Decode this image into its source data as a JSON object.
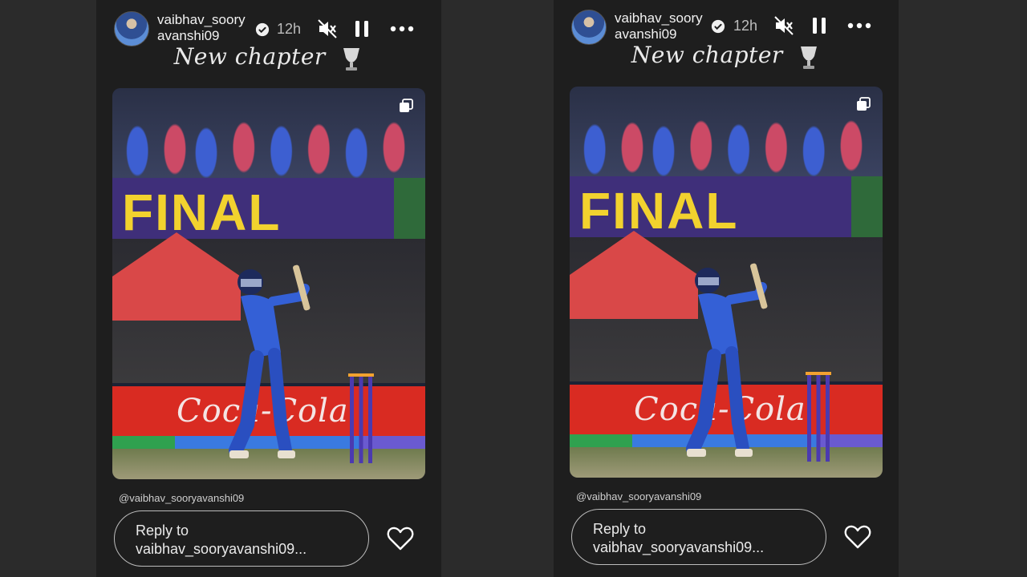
{
  "stories": [
    {
      "username": "vaibhav_sooryavanshi09",
      "time": "12h",
      "caption": "New chapter",
      "banner_text": "FINAL",
      "ad_text": "Coca-Cola",
      "mention": "@vaibhav_sooryavanshi09",
      "reply_placeholder": "Reply to vaibhav_sooryavanshi09..."
    },
    {
      "username": "vaibhav_sooryavanshi09",
      "time": "12h",
      "caption": "New chapter",
      "banner_text": "FINAL",
      "ad_text": "Coca-Cola",
      "mention": "@vaibhav_sooryavanshi09",
      "reply_placeholder": "Reply to vaibhav_sooryavanshi09..."
    }
  ],
  "icons": {
    "verified": "verified-badge-icon",
    "mute": "speaker-muted-icon",
    "pause": "pause-icon",
    "more": "more-horizontal-icon",
    "carousel": "multiple-images-icon",
    "like": "heart-icon",
    "trophy": "trophy-emoji"
  },
  "colors": {
    "background": "#2b2b2b",
    "story_bg": "#1e1e1e",
    "banner": "#3f2f7a",
    "banner_text": "#f2d22e",
    "ad": "#d92b22"
  }
}
